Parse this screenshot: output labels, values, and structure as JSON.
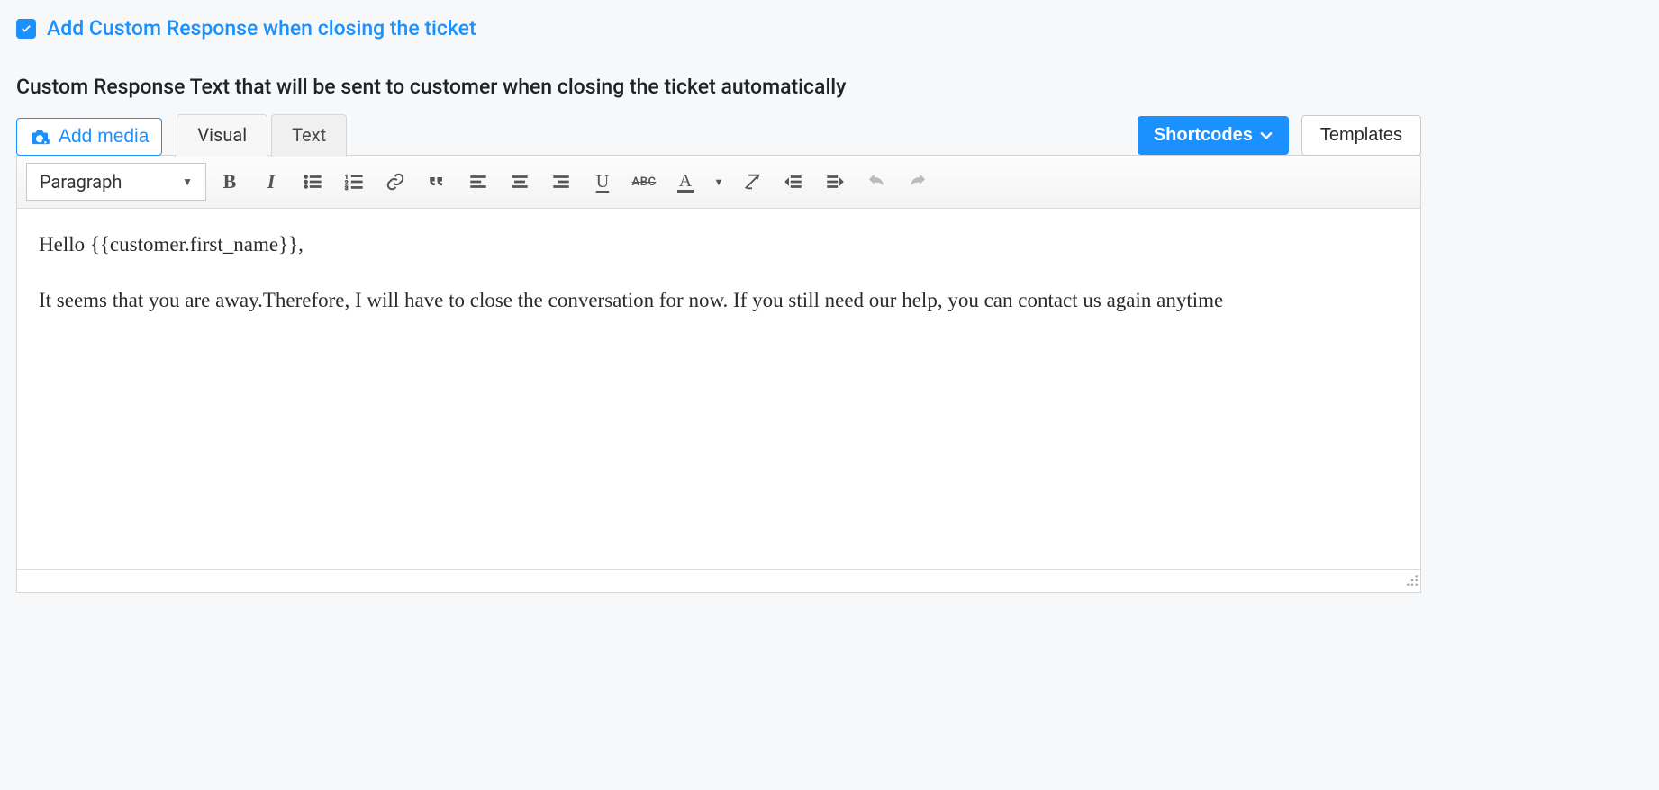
{
  "checkbox": {
    "checked": true,
    "label": "Add Custom Response when closing the ticket"
  },
  "heading": "Custom Response Text that will be sent to customer when closing the ticket automatically",
  "add_media_label": "Add media",
  "tabs": {
    "visual": "Visual",
    "text": "Text"
  },
  "shortcodes_label": "Shortcodes",
  "templates_label": "Templates",
  "toolbar": {
    "format": "Paragraph"
  },
  "content": {
    "p1": "Hello {{customer.first_name}},",
    "p2": "It seems that you are away.Therefore, I will have to close the conversation for now. If you still need our help, you can contact us again anytime"
  }
}
